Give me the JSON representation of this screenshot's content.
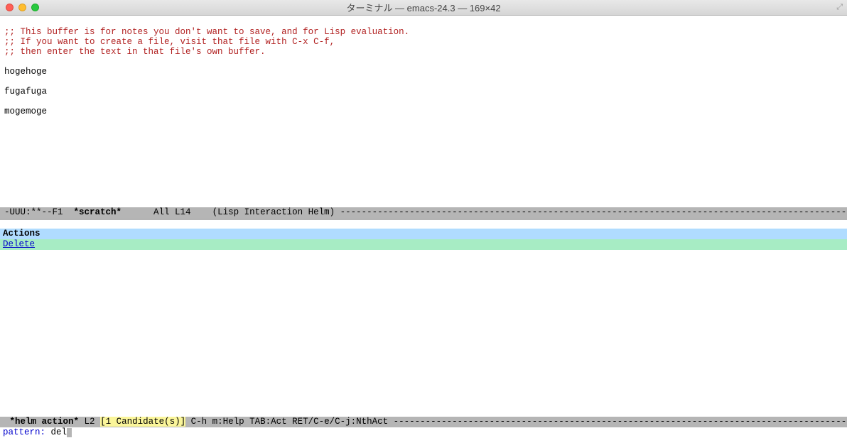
{
  "window": {
    "title": "ターミナル — emacs-24.3 — 169×42"
  },
  "buffer": {
    "comment1": ";; This buffer is for notes you don't want to save, and for Lisp evaluation.",
    "comment2": ";; If you want to create a file, visit that file with C-x C-f,",
    "comment3": ";; then enter the text in that file's own buffer.",
    "line1": "hogehoge",
    "line2": "fugafuga",
    "line3": "mogemoge"
  },
  "modeline1": {
    "left": "-UUU:**--F1  ",
    "buffer_name": "*scratch*",
    "mid": "      All L14    (Lisp Interaction Helm) ",
    "dashes": "------------------------------------------------------------------------------------------------------------------------------"
  },
  "helm": {
    "header": "Actions",
    "candidate": "Delete"
  },
  "modeline2": {
    "pre": " ",
    "buffer_name": "*helm action*",
    "line": " L2 ",
    "candidates": "[1 Candidate(s)]",
    "help": " C-h m:Help TAB:Act RET/C-e/C-j:NthAct ",
    "dashes": "-----------------------------------------------------------------------------------------------------------------------"
  },
  "minibuffer": {
    "prompt": "pattern: ",
    "input": "del"
  }
}
